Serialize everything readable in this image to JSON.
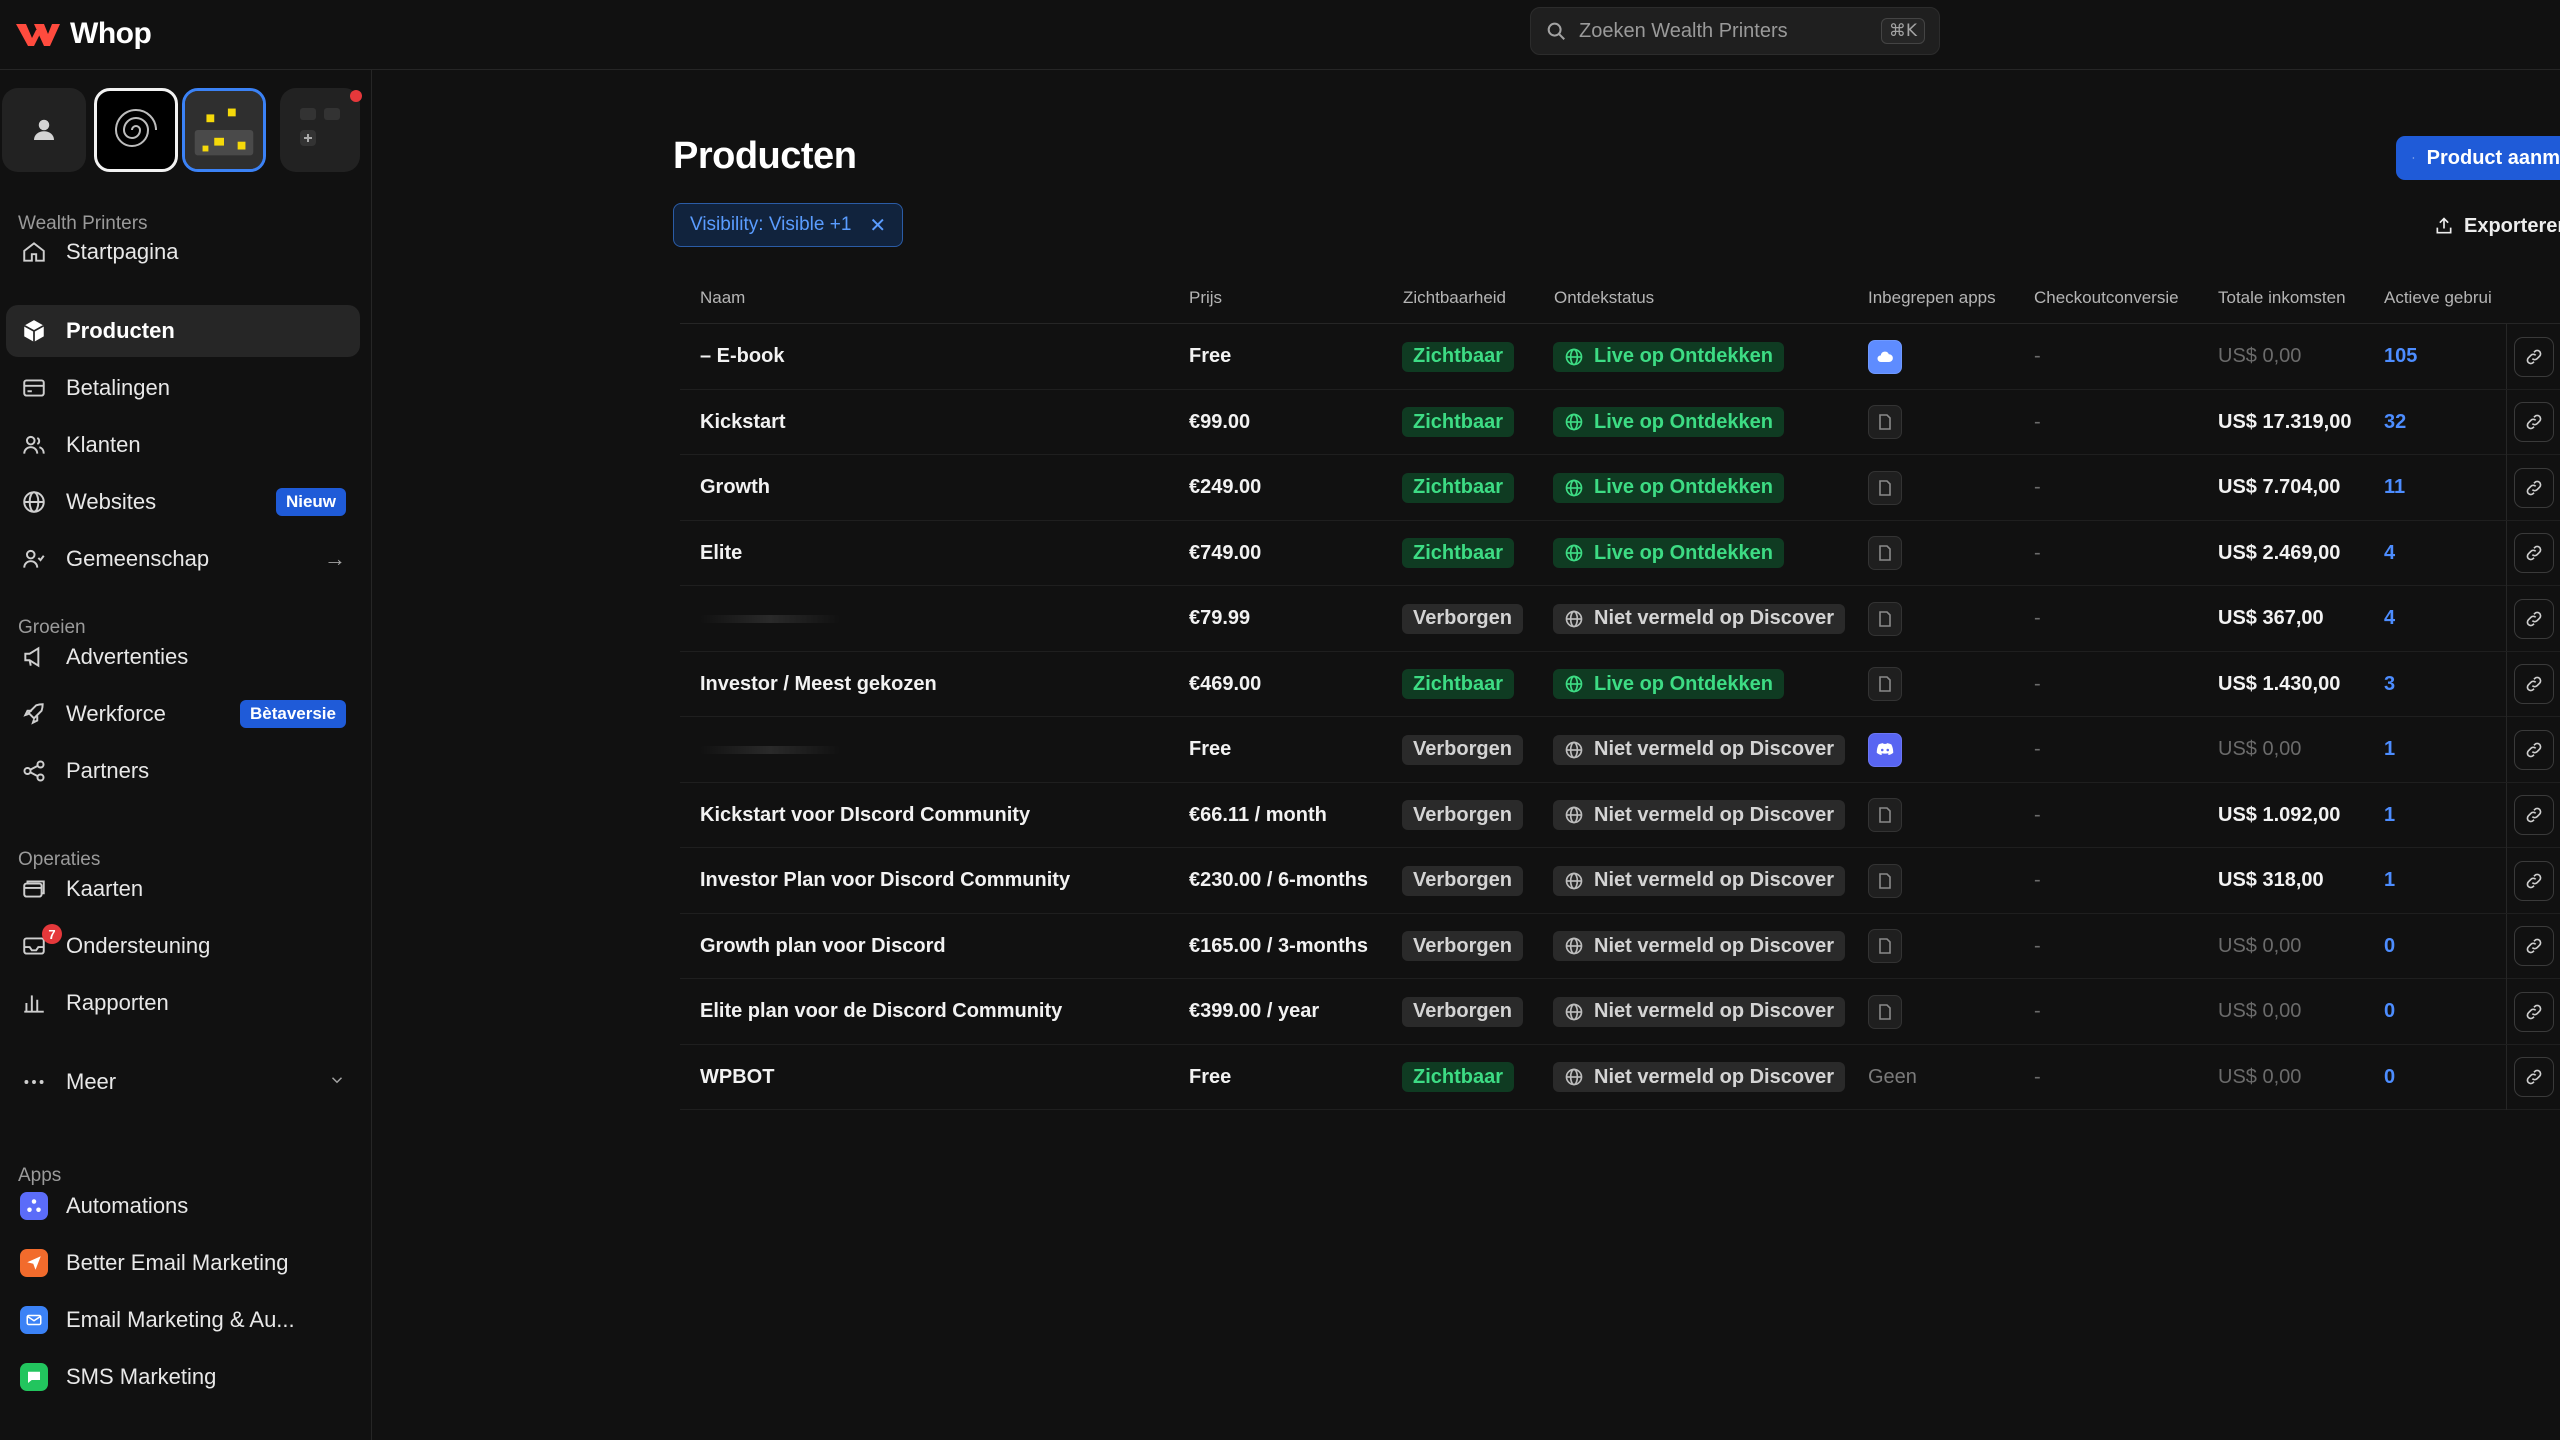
{
  "brand": {
    "name": "Whop",
    "logo_color": "#ff4b3e",
    "accent": "#1f5bd8"
  },
  "search": {
    "placeholder": "Zoeken Wealth Printers",
    "shortcut": "⌘K"
  },
  "sidebar": {
    "workspace_label": "Wealth Printers",
    "main_items": [
      {
        "label": "Startpagina",
        "icon": "home-icon"
      },
      {
        "label": "Producten",
        "icon": "product-cube-icon",
        "active": true
      },
      {
        "label": "Betalingen",
        "icon": "card-icon"
      },
      {
        "label": "Klanten",
        "icon": "users-icon"
      },
      {
        "label": "Websites",
        "icon": "globe-icon",
        "badge": "Nieuw"
      },
      {
        "label": "Gemeenschap",
        "icon": "community-icon",
        "trailing": "→"
      }
    ],
    "grow_label": "Groeien",
    "grow_items": [
      {
        "label": "Advertenties",
        "icon": "megaphone-icon"
      },
      {
        "label": "Werkforce",
        "icon": "rocket-icon",
        "badge": "Bètaversie"
      },
      {
        "label": "Partners",
        "icon": "share-icon"
      }
    ],
    "ops_label": "Operaties",
    "ops_items": [
      {
        "label": "Kaarten",
        "icon": "cards-icon"
      },
      {
        "label": "Ondersteuning",
        "icon": "support-inbox-icon",
        "count": "7"
      },
      {
        "label": "Rapporten",
        "icon": "bar-chart-icon"
      }
    ],
    "more_label": "Meer",
    "apps_label": "Apps",
    "apps": [
      {
        "label": "Automations",
        "icon": "automations-icon",
        "color": "#5b6cf9"
      },
      {
        "label": "Better Email Marketing",
        "icon": "paper-plane-icon",
        "color": "#f26b2c"
      },
      {
        "label": "Email Marketing & Au...",
        "icon": "mail-icon",
        "color": "#3b82f6"
      },
      {
        "label": "SMS Marketing",
        "icon": "chat-bubble-icon",
        "color": "#22c55e"
      }
    ]
  },
  "main": {
    "title": "Producten",
    "create_button": "Product aanm",
    "filter_chip": "Visibility: Visible +1",
    "export_button": "Exporteren",
    "table": {
      "columns": [
        "Naam",
        "Prijs",
        "Zichtbaarheid",
        "Ontdekstatus",
        "Inbegrepen apps",
        "Checkoutconversie",
        "Totale inkomsten",
        "Actieve gebrui"
      ],
      "rows": [
        {
          "name": "– E-book",
          "price": "Free",
          "visibility": "Zichtbaar",
          "visible": true,
          "discover": "Live op Ontdekken",
          "live": true,
          "app": "cloud",
          "conversion": "-",
          "revenue": "US$ 0,00",
          "revenue_zero": true,
          "active": "105"
        },
        {
          "name": "Kickstart",
          "price": "€99.00",
          "visibility": "Zichtbaar",
          "visible": true,
          "discover": "Live op Ontdekken",
          "live": true,
          "app": "file",
          "conversion": "-",
          "revenue": "US$ 17.319,00",
          "revenue_zero": false,
          "active": "32"
        },
        {
          "name": "Growth",
          "price": "€249.00",
          "visibility": "Zichtbaar",
          "visible": true,
          "discover": "Live op Ontdekken",
          "live": true,
          "app": "file",
          "conversion": "-",
          "revenue": "US$ 7.704,00",
          "revenue_zero": false,
          "active": "11"
        },
        {
          "name": "Elite",
          "price": "€749.00",
          "visibility": "Zichtbaar",
          "visible": true,
          "discover": "Live op Ontdekken",
          "live": true,
          "app": "file",
          "conversion": "-",
          "revenue": "US$ 2.469,00",
          "revenue_zero": false,
          "active": "4"
        },
        {
          "name": "",
          "price": "€79.99",
          "visibility": "Verborgen",
          "visible": false,
          "discover": "Niet vermeld op Discover",
          "live": false,
          "app": "file",
          "conversion": "-",
          "revenue": "US$ 367,00",
          "revenue_zero": false,
          "active": "4"
        },
        {
          "name": "Investor / Meest gekozen",
          "price": "€469.00",
          "visibility": "Zichtbaar",
          "visible": true,
          "discover": "Live op Ontdekken",
          "live": true,
          "app": "file",
          "conversion": "-",
          "revenue": "US$ 1.430,00",
          "revenue_zero": false,
          "active": "3"
        },
        {
          "name": "",
          "price": "Free",
          "visibility": "Verborgen",
          "visible": false,
          "discover": "Niet vermeld op Discover",
          "live": false,
          "app": "discord",
          "conversion": "-",
          "revenue": "US$ 0,00",
          "revenue_zero": true,
          "active": "1"
        },
        {
          "name": "Kickstart voor DIscord Community",
          "price": "€66.11 / month",
          "visibility": "Verborgen",
          "visible": false,
          "discover": "Niet vermeld op Discover",
          "live": false,
          "app": "file",
          "conversion": "-",
          "revenue": "US$ 1.092,00",
          "revenue_zero": false,
          "active": "1"
        },
        {
          "name": "Investor Plan voor Discord Community",
          "price": "€230.00 / 6-months",
          "visibility": "Verborgen",
          "visible": false,
          "discover": "Niet vermeld op Discover",
          "live": false,
          "app": "file",
          "conversion": "-",
          "revenue": "US$ 318,00",
          "revenue_zero": false,
          "active": "1"
        },
        {
          "name": "Growth plan voor Discord",
          "price": "€165.00 / 3-months",
          "visibility": "Verborgen",
          "visible": false,
          "discover": "Niet vermeld op Discover",
          "live": false,
          "app": "file",
          "conversion": "-",
          "revenue": "US$ 0,00",
          "revenue_zero": true,
          "active": "0"
        },
        {
          "name": "Elite plan voor de Discord Community",
          "price": "€399.00 / year",
          "visibility": "Verborgen",
          "visible": false,
          "discover": "Niet vermeld op Discover",
          "live": false,
          "app": "file",
          "conversion": "-",
          "revenue": "US$ 0,00",
          "revenue_zero": true,
          "active": "0"
        },
        {
          "name": "WPBOT",
          "price": "Free",
          "visibility": "Zichtbaar",
          "visible": true,
          "discover": "Niet vermeld op Discover",
          "live": false,
          "app": "none",
          "app_text": "Geen",
          "conversion": "-",
          "revenue": "US$ 0,00",
          "revenue_zero": true,
          "active": "0"
        }
      ]
    }
  }
}
